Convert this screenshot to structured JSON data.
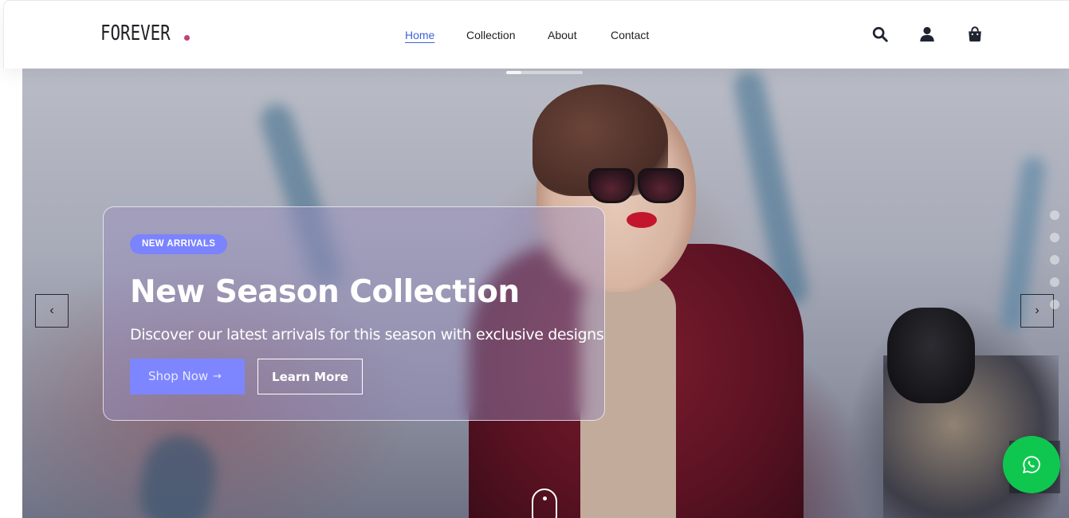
{
  "header": {
    "logo_text": "FOREVER",
    "nav": [
      {
        "label": "Home",
        "active": true
      },
      {
        "label": "Collection",
        "active": false
      },
      {
        "label": "About",
        "active": false
      },
      {
        "label": "Contact",
        "active": false
      }
    ],
    "icons": [
      "search-icon",
      "user-icon",
      "shopping-bag-icon"
    ]
  },
  "hero": {
    "slide_progress": 0.2,
    "badge": "NEW ARRIVALS",
    "title": "New Season Collection",
    "subtitle": "Discover our latest arrivals for this season with exclusive designs",
    "primary_button": "Shop Now",
    "secondary_button": "Learn More",
    "prev_icon": "chevron-left-icon",
    "next_icon": "chevron-right-icon",
    "slide_dots_count": 5
  },
  "colors": {
    "accent": "#7b83ff",
    "active_nav": "#3d63d8",
    "logo_dot": "#c3407b",
    "whatsapp": "#0fc74f"
  },
  "whatsapp": {
    "icon": "whatsapp-icon"
  }
}
